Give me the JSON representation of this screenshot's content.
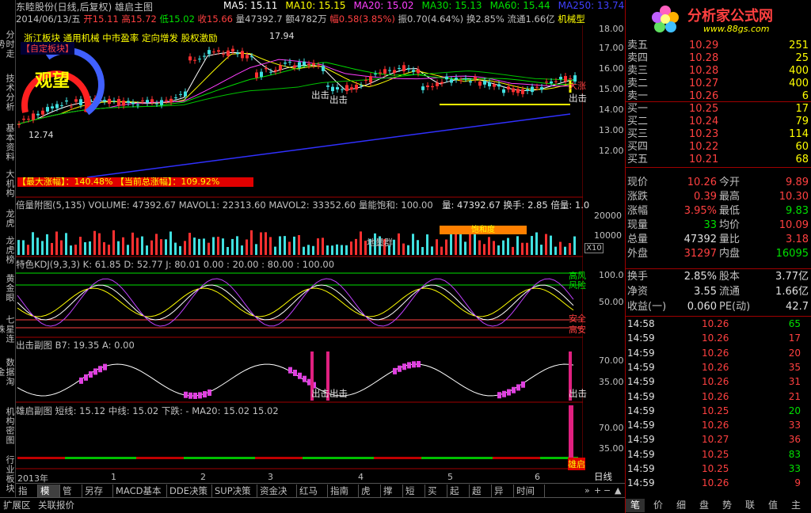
{
  "left_tabs": [
    "分时走势",
    "技术分析",
    "基本资料",
    "大机构",
    "龙虎",
    "龙虎榜",
    "黄金眼",
    "七星连珠",
    "数据淘金",
    "机构密图",
    "行业板块"
  ],
  "header": {
    "title": "东睦股份(日线,后复权) 雄启主图",
    "ma": [
      {
        "t": "MA5: 15.11",
        "c": "#ffffff"
      },
      {
        "t": "MA10: 15.15",
        "c": "#ffff00"
      },
      {
        "t": "MA20: 15.02",
        "c": "#ff40ff"
      },
      {
        "t": "MA30: 15.13",
        "c": "#00e000"
      },
      {
        "t": "MA60: 15.44",
        "c": "#00e000"
      },
      {
        "t": "MA250: 13.74",
        "c": "#4040ff"
      }
    ]
  },
  "info": [
    {
      "t": "2014/06/13/五 ",
      "c": "#c0c0c0"
    },
    {
      "t": "开15.11 ",
      "c": "#ff4040"
    },
    {
      "t": "高15.72 ",
      "c": "#ff4040"
    },
    {
      "t": "低15.02 ",
      "c": "#00e000"
    },
    {
      "t": "收15.66 ",
      "c": "#ff4040"
    },
    {
      "t": "量47392.7 ",
      "c": "#c0c0c0"
    },
    {
      "t": "额4782万 ",
      "c": "#c0c0c0"
    },
    {
      "t": "幅0.58(3.85%) ",
      "c": "#ff4040"
    },
    {
      "t": "振0.70(4.64%) ",
      "c": "#c0c0c0"
    },
    {
      "t": "换2.85% ",
      "c": "#c0c0c0"
    },
    {
      "t": "流通1.66亿 ",
      "c": "#c0c0c0"
    },
    {
      "t": "机械型",
      "c": "#ffff00"
    }
  ],
  "tags": "浙江板块  通用机械  中市盈率  定向增发  股权激励",
  "custom_block": "【自定板块】",
  "gauge": "观望",
  "price_high": "17.94",
  "price_low": "12.74",
  "chuji": [
    "出击",
    "出击",
    "出击"
  ],
  "dalian_label": "大涨",
  "max_rise": "【最大涨幅】：140.48%  【当前总涨幅】：109.92%",
  "price_axis": [
    "18.00",
    "17.00",
    "16.00",
    "15.00",
    "14.00",
    "13.00",
    "12.00"
  ],
  "vol_header": "倍量附图(5,135)  VOLUME: 47392.67  MAVOL1: 22313.60  MAVOL2: 33352.60  量能饱和: 100.00",
  "vol_right": "量: 47392.67  换手: 2.85  倍量: 1.0",
  "vol_axis": [
    "20000",
    "10000"
  ],
  "vol_unit": "X10",
  "vol_badge": "饱和度",
  "vol_group": "地量群",
  "kdj_header": "特色KDJ(9,3,3)  K: 61.85  D: 52.77  J: 80.01   0.00 : 20.00 : 80.00 : 100.00",
  "kdj_axis": [
    "100.0",
    "50.00"
  ],
  "kdj_labels": [
    "高风",
    "风险",
    "安全",
    "高安"
  ],
  "chuji_header": "出击副图  B7: 19.35  A: 0.00",
  "chuji_axis": [
    "70.00",
    "35.00"
  ],
  "chuji_marks": [
    "出击出击",
    "出击"
  ],
  "xiong_header": "雄启副图  短线: 15.12  中线: 15.02  下跌: -  MA20: 15.02  15.02",
  "xiong_axis": [
    "70.00",
    "35.00"
  ],
  "xiong_mark": "雄启",
  "x_axis": [
    "2013年",
    "1",
    "2",
    "3",
    "4",
    "5",
    "6"
  ],
  "period": "日线",
  "bottom_tabs": [
    "指标",
    "模板",
    "管理",
    "另存为",
    "MACD基本",
    "DDE决策",
    "SUP决策",
    "资金决策",
    "红马甲",
    "指南针",
    "虎拓",
    "撑压",
    "短线",
    "买入",
    "起爆",
    "超前",
    "异动",
    "时间窗"
  ],
  "bottom2": [
    "扩展区",
    "关联报价"
  ],
  "logo": {
    "title": "分析家公式网",
    "url": "www.88gs.com"
  },
  "sell": [
    {
      "n": "卖五",
      "p": "10.29",
      "v": "251"
    },
    {
      "n": "卖四",
      "p": "10.28",
      "v": "25"
    },
    {
      "n": "卖三",
      "p": "10.28",
      "v": "400"
    },
    {
      "n": "卖二",
      "p": "10.27",
      "v": "400"
    },
    {
      "n": "卖一",
      "p": "10.26",
      "v": "6"
    }
  ],
  "buy": [
    {
      "n": "买一",
      "p": "10.25",
      "v": "17"
    },
    {
      "n": "买二",
      "p": "10.24",
      "v": "79"
    },
    {
      "n": "买三",
      "p": "10.23",
      "v": "114"
    },
    {
      "n": "买四",
      "p": "10.22",
      "v": "60"
    },
    {
      "n": "买五",
      "p": "10.21",
      "v": "68"
    }
  ],
  "quote": [
    {
      "a": "现价",
      "av": "10.26",
      "ac": "#ff4040",
      "b": "今开",
      "bv": "9.89",
      "bc": "#ff4040"
    },
    {
      "a": "涨跌",
      "av": "0.39",
      "ac": "#ff4040",
      "b": "最高",
      "bv": "10.30",
      "bc": "#ff4040"
    },
    {
      "a": "涨幅",
      "av": "3.95%",
      "ac": "#ff4040",
      "b": "最低",
      "bv": "9.83",
      "bc": "#00e000"
    },
    {
      "a": "现量",
      "av": "33",
      "ac": "#00e000",
      "b": "均价",
      "bv": "10.09",
      "bc": "#ff4040"
    },
    {
      "a": "总量",
      "av": "47392",
      "ac": "#e0e0e0",
      "b": "量比",
      "bv": "3.18",
      "bc": "#ff4040"
    },
    {
      "a": "外盘",
      "av": "31297",
      "ac": "#ff4040",
      "b": "内盘",
      "bv": "16095",
      "bc": "#00e000"
    }
  ],
  "stats": [
    {
      "a": "换手",
      "av": "2.85%",
      "b": "股本",
      "bv": "3.77亿"
    },
    {
      "a": "净资",
      "av": "3.55",
      "b": "流通",
      "bv": "1.66亿"
    },
    {
      "a": "收益(一)",
      "av": "0.060",
      "b": "PE(动)",
      "bv": "42.7"
    }
  ],
  "ticks": [
    {
      "t": "14:58",
      "p": "10.26",
      "v": "65",
      "c": "#00e000"
    },
    {
      "t": "14:59",
      "p": "10.26",
      "v": "17",
      "c": "#ff4040"
    },
    {
      "t": "14:59",
      "p": "10.26",
      "v": "20",
      "c": "#ff4040"
    },
    {
      "t": "14:59",
      "p": "10.26",
      "v": "35",
      "c": "#ff4040"
    },
    {
      "t": "14:59",
      "p": "10.26",
      "v": "31",
      "c": "#ff4040"
    },
    {
      "t": "14:59",
      "p": "10.26",
      "v": "21",
      "c": "#ff4040"
    },
    {
      "t": "14:59",
      "p": "10.25",
      "v": "20",
      "c": "#00e000"
    },
    {
      "t": "14:59",
      "p": "10.26",
      "v": "33",
      "c": "#ff4040"
    },
    {
      "t": "14:59",
      "p": "10.27",
      "v": "36",
      "c": "#ff4040"
    },
    {
      "t": "14:59",
      "p": "10.25",
      "v": "83",
      "c": "#00e000"
    },
    {
      "t": "14:59",
      "p": "10.25",
      "v": "33",
      "c": "#00e000"
    },
    {
      "t": "14:59",
      "p": "10.26",
      "v": "9",
      "c": "#ff4040"
    }
  ],
  "right_tabs": [
    "笔",
    "价",
    "细",
    "盘",
    "势",
    "联",
    "值",
    "主"
  ]
}
